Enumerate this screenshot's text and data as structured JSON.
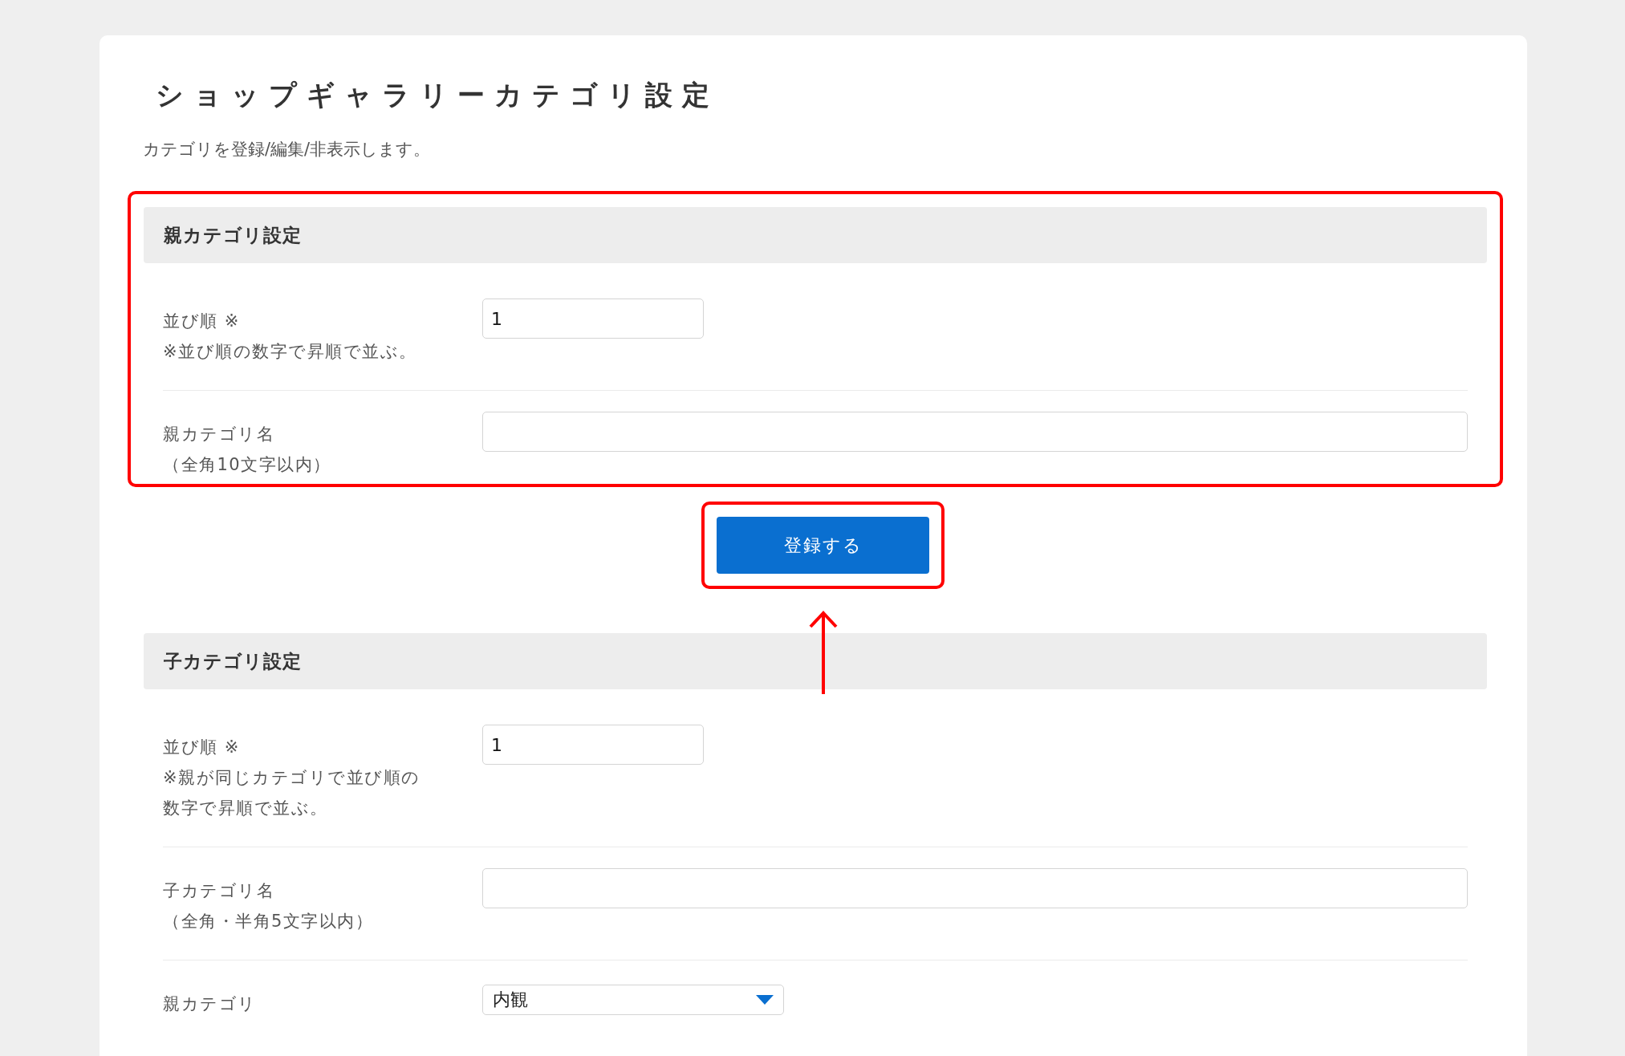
{
  "page": {
    "title": "ショップギャラリーカテゴリ設定",
    "description": "カテゴリを登録/編集/非表示します。"
  },
  "sections": [
    {
      "heading": "親カテゴリ設定",
      "highlighted": true,
      "fields": [
        {
          "kind": "short",
          "lines": [
            "並び順 ※",
            "※並び順の数字で昇順で並ぶ。"
          ],
          "value": "1"
        },
        {
          "kind": "long",
          "lines": [
            "親カテゴリ名",
            "（全角10文字以内）"
          ]
        }
      ]
    },
    {
      "heading": "子カテゴリ設定",
      "highlighted": false,
      "fields": [
        {
          "kind": "short",
          "lines": [
            "並び順 ※",
            "※親が同じカテゴリで並び順の",
            "数字で昇順で並ぶ。"
          ],
          "value": "1"
        },
        {
          "kind": "long",
          "lines": [
            "子カテゴリ名",
            "（全角・半角5文字以内）"
          ]
        },
        {
          "kind": "select",
          "lines": [
            "親カテゴリ"
          ],
          "value": "内観"
        }
      ]
    }
  ],
  "submit": {
    "label": "登録する",
    "highlighted": true,
    "arrow": true
  }
}
